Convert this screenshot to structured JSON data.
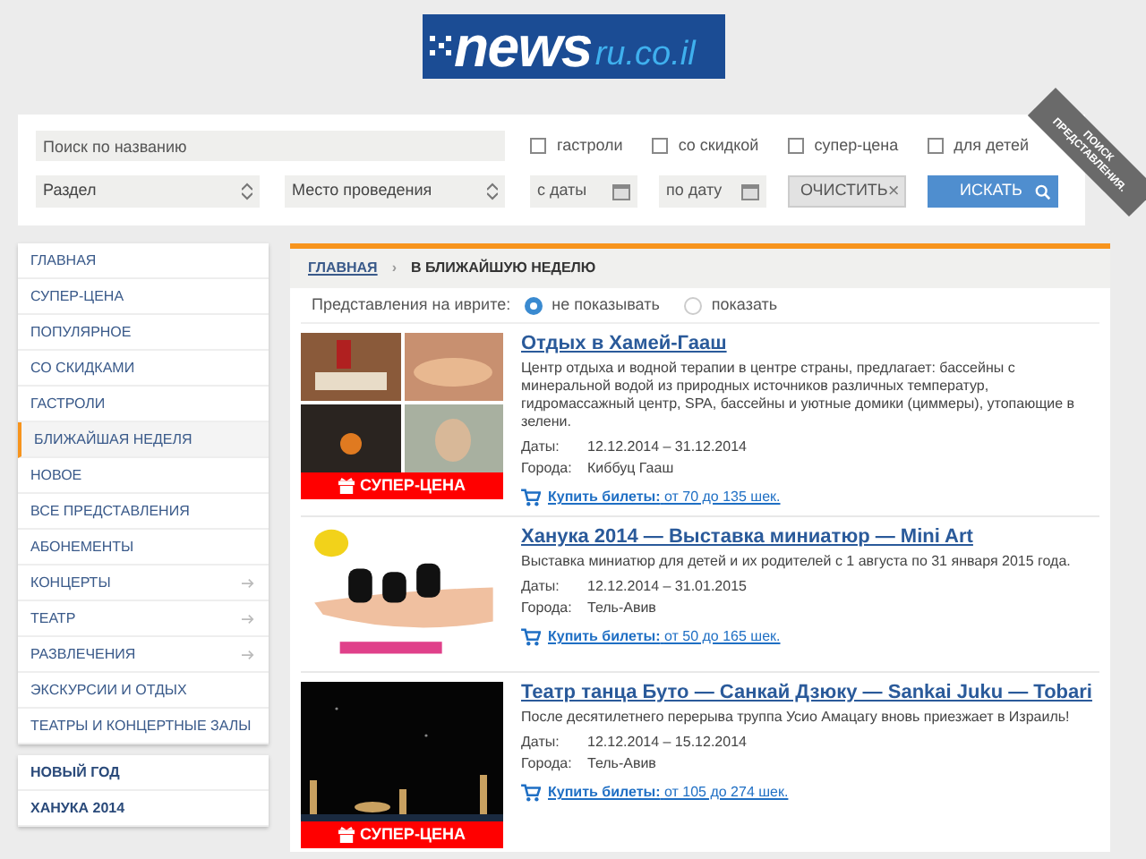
{
  "logo": {
    "main": "news",
    "suffix": "ru.co.il"
  },
  "search": {
    "name_placeholder": "Поиск по названию",
    "checkboxes": [
      {
        "label": "гастроли",
        "checked": false
      },
      {
        "label": "со скидкой",
        "checked": false
      },
      {
        "label": "супер-цена",
        "checked": false
      },
      {
        "label": "для детей",
        "checked": false
      }
    ],
    "section": "Раздел",
    "venue": "Место проведения",
    "date_from": "с даты",
    "date_to": "по дату",
    "clear": "ОЧИСТИТЬ",
    "clear_x": "×",
    "submit": "ИСКАТЬ",
    "ribbon": [
      "ПОИСК",
      "ПРЕДСТАВЛЕНИЯ."
    ]
  },
  "sidebar": {
    "items": [
      {
        "label": "ГЛАВНАЯ",
        "selected": false,
        "arrow": false
      },
      {
        "label": "СУПЕР-ЦЕНА",
        "selected": false,
        "arrow": false
      },
      {
        "label": "ПОПУЛЯРНОЕ",
        "selected": false,
        "arrow": false
      },
      {
        "label": "СО СКИДКАМИ",
        "selected": false,
        "arrow": false
      },
      {
        "label": "ГАСТРОЛИ",
        "selected": false,
        "arrow": false
      },
      {
        "label": "БЛИЖАЙШАЯ НЕДЕЛЯ",
        "selected": true,
        "arrow": false
      },
      {
        "label": "НОВОЕ",
        "selected": false,
        "arrow": false
      },
      {
        "label": "ВСЕ ПРЕДСТАВЛЕНИЯ",
        "selected": false,
        "arrow": false
      },
      {
        "label": "АБОНЕМЕНТЫ",
        "selected": false,
        "arrow": false
      },
      {
        "label": "КОНЦЕРТЫ",
        "selected": false,
        "arrow": true
      },
      {
        "label": "ТЕАТР",
        "selected": false,
        "arrow": true
      },
      {
        "label": "РАЗВЛЕЧЕНИЯ",
        "selected": false,
        "arrow": true
      },
      {
        "label": "ЭКСКУРСИИ И ОТДЫХ",
        "selected": false,
        "arrow": false
      },
      {
        "label": "ТЕАТРЫ И КОНЦЕРТНЫЕ ЗАЛЫ",
        "selected": false,
        "arrow": false
      }
    ],
    "specials": [
      "НОВЫЙ ГОД",
      "ХАНУКА 2014"
    ]
  },
  "breadcrumb": {
    "home": "ГЛАВНАЯ",
    "separator": "›",
    "current": "В БЛИЖАЙШУЮ НЕДЕЛЮ"
  },
  "hebrew_filter": {
    "label": "Представления на иврите:",
    "options": [
      {
        "label": "не показывать",
        "selected": true
      },
      {
        "label": "показать",
        "selected": false
      }
    ]
  },
  "events": [
    {
      "title": "Отдых в Хамей-Гааш",
      "description": "Центр отдыха и водной терапии в центре страны, предлагает: бассейны с минеральной водой из природных источников различных температур, гидромассажный центр, SPA, бассейны и уютные домики (циммеры), утопающие в зелени.",
      "dates_label": "Даты:",
      "dates": "12.12.2014 – 31.12.2014",
      "city_label": "Города:",
      "city": "Киббуц Гааш",
      "buy": "Купить билеты:",
      "price": "от 70 до 135 шек.",
      "badge": "СУПЕР-ЦЕНА",
      "kind": "collage"
    },
    {
      "title": "Ханука 2014 — Выставка миниатюр — Mini Art",
      "description": "Выставка миниатюр для детей и их родителей с 1 августа по 31 января 2015 года.",
      "dates_label": "Даты:",
      "dates": "12.12.2014 – 31.01.2015",
      "city_label": "Города:",
      "city": "Тель-Авив",
      "buy": "Купить билеты:",
      "price": "от 50 до 165 шек.",
      "kind": "hand"
    },
    {
      "title": "Театр танца Буто — Санкай Дзюку — Sankai Juku — Tobari",
      "description": "После десятилетнего перерыва труппа Усио Амацагу вновь приезжает в Израиль!",
      "dates_label": "Даты:",
      "dates": "12.12.2014 – 15.12.2014",
      "city_label": "Города:",
      "city": "Тель-Авив",
      "buy": "Купить билеты:",
      "price": "от 105 до 274 шек.",
      "badge": "СУПЕР-ЦЕНА",
      "kind": "stage"
    }
  ]
}
